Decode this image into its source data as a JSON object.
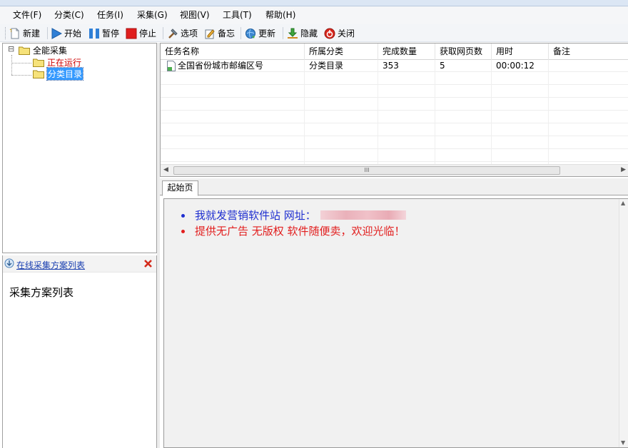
{
  "menubar": {
    "items": [
      "文件(F)",
      "分类(C)",
      "任务(I)",
      "采集(G)",
      "视图(V)",
      "工具(T)",
      "帮助(H)"
    ]
  },
  "toolbar": {
    "buttons": [
      {
        "label": "新建",
        "icon": "new-document-icon"
      },
      {
        "label": "开始",
        "icon": "play-icon"
      },
      {
        "label": "暂停",
        "icon": "pause-icon"
      },
      {
        "label": "停止",
        "icon": "stop-icon"
      },
      {
        "label": "选项",
        "icon": "hammer-icon"
      },
      {
        "label": "备忘",
        "icon": "memo-icon"
      },
      {
        "label": "更新",
        "icon": "globe-refresh-icon"
      },
      {
        "label": "隐藏",
        "icon": "download-hide-icon"
      },
      {
        "label": "关闭",
        "icon": "power-close-icon"
      }
    ]
  },
  "tree": {
    "root": {
      "label": "全能采集",
      "expander": "⊟"
    },
    "children": [
      {
        "label": "正在运行",
        "color": "#cc0000",
        "selected": false
      },
      {
        "label": "分类目录",
        "color": "#ffffff",
        "selected": true
      }
    ]
  },
  "online": {
    "link_label": "在线采集方案列表",
    "close_icon": "close-x-icon",
    "body_text": "采集方案列表"
  },
  "grid": {
    "columns": [
      "任务名称",
      "所属分类",
      "完成数量",
      "获取网页数",
      "用时",
      "备注"
    ],
    "rows": [
      {
        "name": "全国省份城市邮编区号",
        "category": "分类目录",
        "done": "353",
        "pages": "5",
        "time": "00:00:12",
        "note": ""
      }
    ],
    "scroll_grip": "III"
  },
  "tabs": {
    "items": [
      "起始页"
    ]
  },
  "startpage": {
    "line1": "我就发营销软件站 网址：",
    "line1_color": "#1f2fd0",
    "line2": "提供无广告 无版权 软件随便卖，欢迎光临！",
    "line2_color": "#e21e1e"
  },
  "colors": {
    "selection": "#3399ff",
    "folder": "#f6e27a"
  }
}
